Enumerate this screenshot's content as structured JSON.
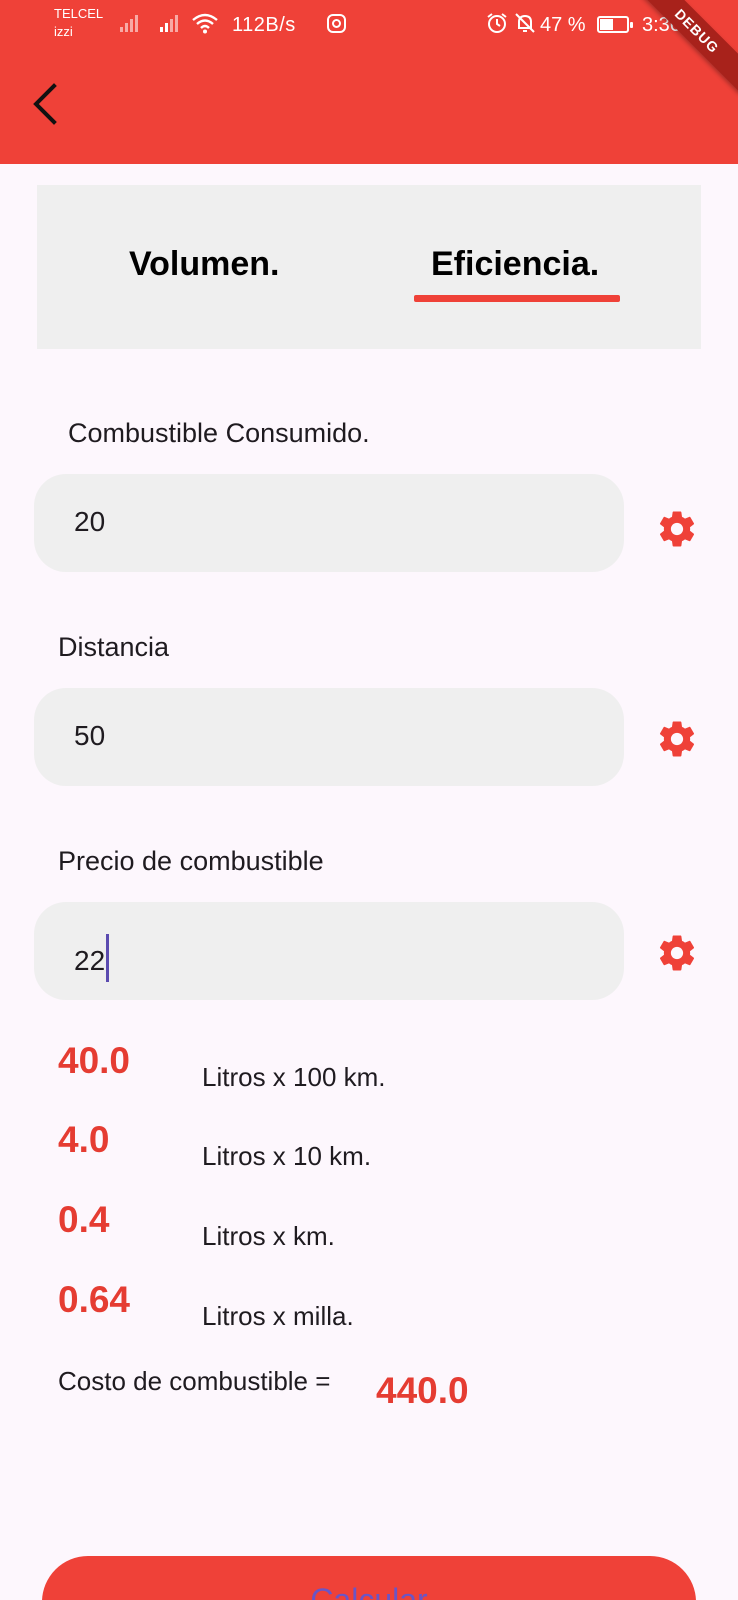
{
  "status_bar": {
    "carrier_1": "TELCEL",
    "carrier_2": "izzi",
    "net_speed": "112B/s",
    "battery_pct": "47 %",
    "time": "3:36",
    "icons": [
      "signal-icon",
      "signal-icon",
      "wifi-icon",
      "instagram-icon",
      "alarm-icon",
      "bell-off-icon",
      "battery-icon"
    ]
  },
  "debug_banner": "DEBUG",
  "colors": {
    "primary": "#ef4138",
    "result": "#e53c32",
    "field_bg": "#efefef",
    "page_bg": "#fdf7fd",
    "caret": "#5b4bb0"
  },
  "tabs": [
    {
      "label": "Volumen.",
      "selected": false
    },
    {
      "label": "Eficiencia.",
      "selected": true
    }
  ],
  "form": {
    "fuel_label": "Combustible Consumido.",
    "fuel_value": "20",
    "distance_label": "Distancia",
    "distance_value": "50",
    "price_label": "Precio de combustible",
    "price_value": "22"
  },
  "results": [
    {
      "value": "40.0",
      "unit": "Litros x 100 km."
    },
    {
      "value": "4.0",
      "unit": "Litros x 10 km."
    },
    {
      "value": "0.4",
      "unit": "Litros x km."
    },
    {
      "value": "0.64",
      "unit": "Litros x milla."
    }
  ],
  "cost": {
    "label": "Costo de combustible =",
    "value": "440.0"
  },
  "calculate_label": "Calcular"
}
